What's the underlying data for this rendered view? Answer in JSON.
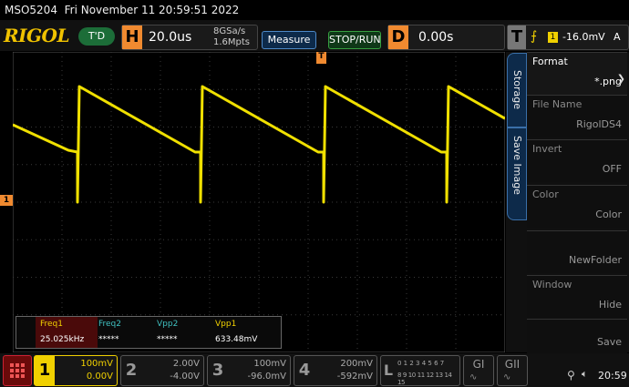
{
  "status": {
    "model": "MSO5204",
    "datetime": "Fri November 11 20:59:51 2022"
  },
  "brand": "RIGOL",
  "trigger_state": "T'D",
  "horizontal": {
    "label": "H",
    "timebase": "20.0us",
    "sample_rate": "8GSa/s",
    "memory": "1.6Mpts"
  },
  "buttons": {
    "measure": "Measure",
    "stop_run": "STOP/RUN"
  },
  "delay": {
    "label": "D",
    "value": "0.00s"
  },
  "trigger": {
    "label": "T",
    "channel": "1",
    "level": "-16.0mV",
    "mode": "A"
  },
  "measurements": [
    {
      "name": "Freq1",
      "value": "25.025kHz",
      "color": "#f0d000"
    },
    {
      "name": "Freq2",
      "value": "*****",
      "color": "#40c0c0"
    },
    {
      "name": "Vpp2",
      "value": "*****",
      "color": "#40c0c0"
    },
    {
      "name": "Vpp1",
      "value": "633.48mV",
      "color": "#f0d000"
    }
  ],
  "side_tabs": {
    "storage": "Storage",
    "save_image": "Save Image"
  },
  "menu": [
    {
      "label": "Format",
      "value": "*.png"
    },
    {
      "label": "File Name",
      "value": "RigolDS4"
    },
    {
      "label": "Invert",
      "value": "OFF"
    },
    {
      "label": "Color",
      "value": "Color"
    },
    {
      "label": "",
      "value": "NewFolder"
    },
    {
      "label": "Window",
      "value": "Hide"
    },
    {
      "label": "",
      "value": "Save"
    }
  ],
  "channels": [
    {
      "num": "1",
      "scale": "100mV",
      "offset": "0.00V",
      "color": "#f0d000"
    },
    {
      "num": "2",
      "scale": "2.00V",
      "offset": "-4.00V",
      "color": "#888888"
    },
    {
      "num": "3",
      "scale": "100mV",
      "offset": "-96.0mV",
      "color": "#888888"
    },
    {
      "num": "4",
      "scale": "200mV",
      "offset": "-592mV",
      "color": "#888888"
    }
  ],
  "logic": {
    "label": "L",
    "row1": "0 1 2 3 4 5 6 7",
    "row2": "8 9 10 11 12 13 14 15"
  },
  "gi": "GI",
  "gii": "GII",
  "clock": "20:59",
  "colors": {
    "trace": "#f0e000",
    "accent": "#f08a30"
  }
}
